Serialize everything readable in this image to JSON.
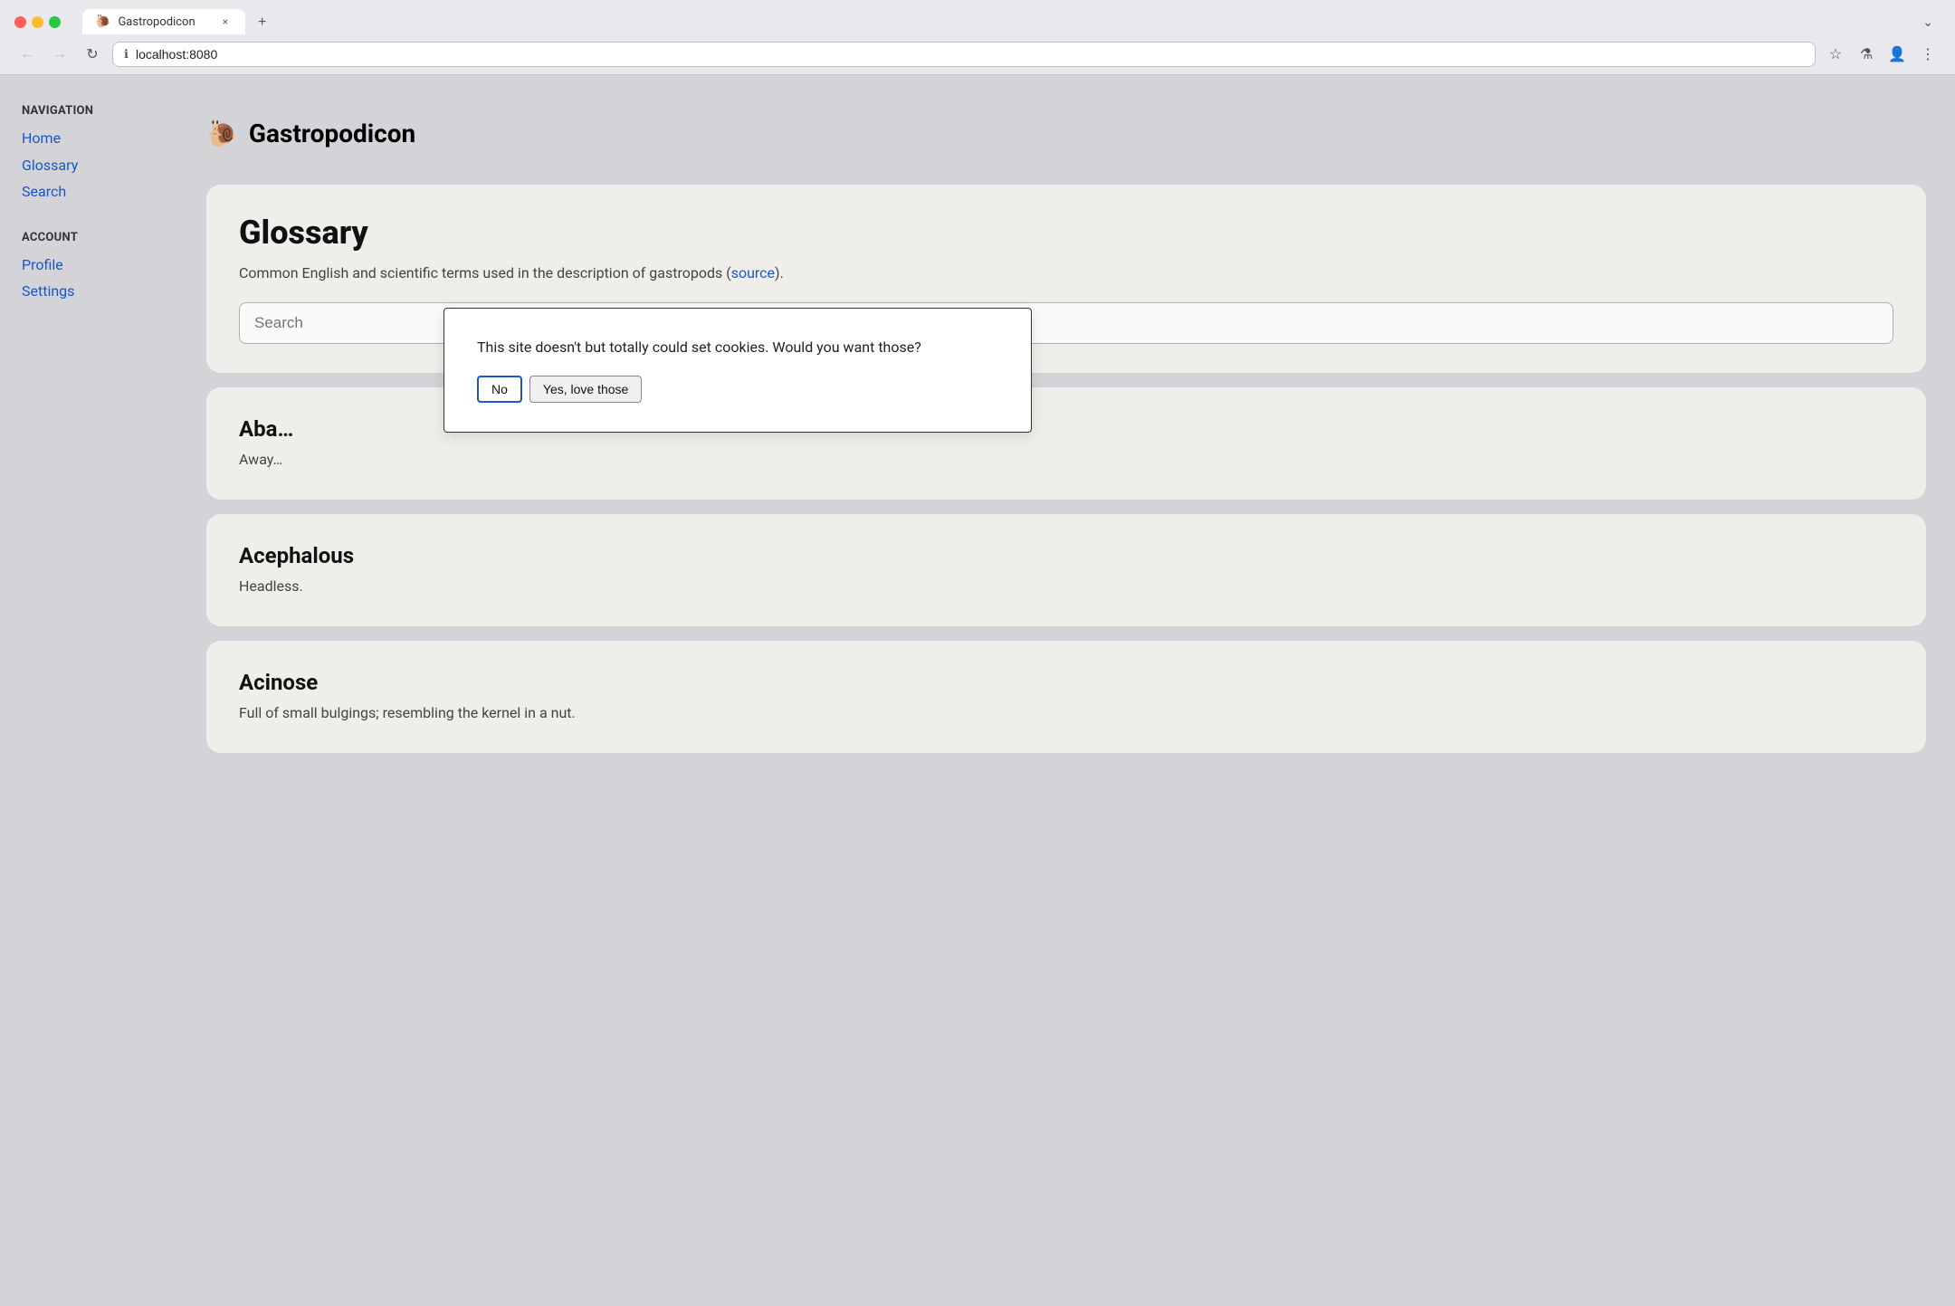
{
  "browser": {
    "tab_favicon": "🐌",
    "tab_title": "Gastropodicon",
    "tab_close": "×",
    "new_tab": "+",
    "tab_dropdown": "⌄",
    "address": "localhost:8080",
    "back_icon": "←",
    "forward_icon": "→",
    "reload_icon": "↻",
    "security_icon": "ℹ",
    "bookmark_icon": "☆",
    "extension_icon": "⚗",
    "account_icon": "👤",
    "menu_icon": "⋮"
  },
  "app": {
    "logo": "🐌",
    "title": "Gastropodicon"
  },
  "sidebar": {
    "nav_section_title": "NAVIGATION",
    "nav_links": [
      {
        "label": "Home",
        "href": "#"
      },
      {
        "label": "Glossary",
        "href": "#"
      },
      {
        "label": "Search",
        "href": "#"
      }
    ],
    "account_section_title": "ACCOUNT",
    "account_links": [
      {
        "label": "Profile",
        "href": "#"
      },
      {
        "label": "Settings",
        "href": "#"
      }
    ]
  },
  "glossary": {
    "title": "Glossary",
    "description_text": "Common English and scientific terms used in the description of gastropods (",
    "description_link_text": "source",
    "description_end": ").",
    "search_placeholder": "Search",
    "entries": [
      {
        "term": "Aba…",
        "definition": "Away…"
      },
      {
        "term": "Acephalous",
        "definition": "Headless."
      },
      {
        "term": "Acinose",
        "definition": "Full of small bulgings; resembling the kernel in a nut."
      }
    ]
  },
  "cookie_dialog": {
    "message": "This site doesn't but totally could set cookies. Would you want those?",
    "btn_no": "No",
    "btn_yes": "Yes, love those"
  }
}
